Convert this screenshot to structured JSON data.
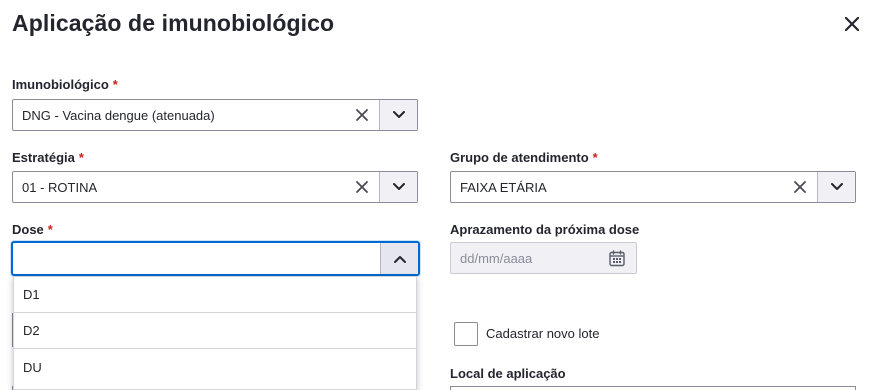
{
  "modal": {
    "title": "Aplicação de imunobiológico",
    "close_icon": "close-icon"
  },
  "imunobiologico": {
    "label": "Imunobiológico",
    "required": "*",
    "value": "DNG - Vacina dengue (atenuada)"
  },
  "estrategia": {
    "label": "Estratégia",
    "required": "*",
    "value": "01 - ROTINA"
  },
  "grupo": {
    "label": "Grupo de atendimento",
    "required": "*",
    "value": "FAIXA ETÁRIA"
  },
  "dose": {
    "label": "Dose",
    "required": "*",
    "value": "",
    "options": [
      "D1",
      "D2",
      "DU"
    ]
  },
  "aprazamento": {
    "label": "Aprazamento da próxima dose",
    "placeholder": "dd/mm/aaaa"
  },
  "novo_lote": {
    "label": "Cadastrar novo lote",
    "checked": false
  },
  "local": {
    "label": "Local de aplicação"
  },
  "colors": {
    "required": "#d01e1e",
    "focus": "#0069d0",
    "text": "#24252e",
    "border": "#8a8c99"
  }
}
